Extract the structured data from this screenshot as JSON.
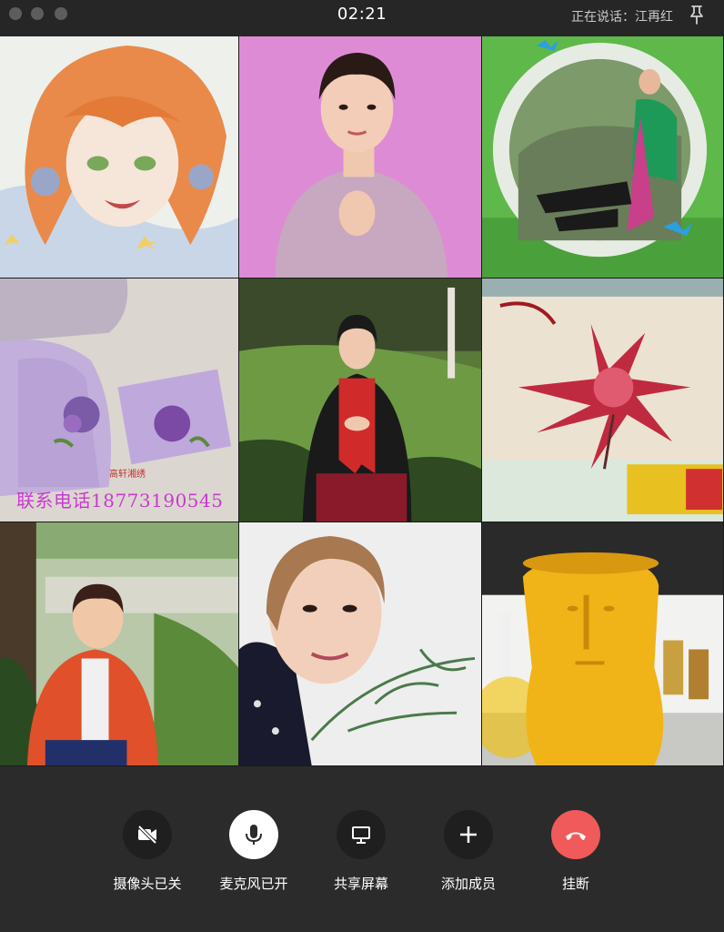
{
  "window": {
    "time": "02:21",
    "speaking_label": "正在说话：江再红"
  },
  "tiles": [
    {
      "name": "participant-tile-1",
      "subject": "anime character avatar"
    },
    {
      "name": "participant-tile-2",
      "subject": "woman in pink sweater"
    },
    {
      "name": "participant-tile-3",
      "subject": "woman sitting on grass frame"
    },
    {
      "name": "participant-tile-4",
      "subject": "embroidered silk products",
      "overlay_text": "联系电话18773190545",
      "brand_mark": "高轩湘绣"
    },
    {
      "name": "participant-tile-5",
      "subject": "woman in red scarf"
    },
    {
      "name": "participant-tile-6",
      "subject": "embroidered red flower"
    },
    {
      "name": "participant-tile-7",
      "subject": "woman in orange coat"
    },
    {
      "name": "participant-tile-8",
      "subject": "woman selfie with plant"
    },
    {
      "name": "participant-tile-9",
      "subject": "yellow statue figure"
    }
  ],
  "controls": {
    "camera": {
      "label": "摄像头已关",
      "icon": "camera-off-icon"
    },
    "mic": {
      "label": "麦克风已开",
      "icon": "microphone-icon"
    },
    "share": {
      "label": "共享屏幕",
      "icon": "screen-share-icon"
    },
    "add": {
      "label": "添加成员",
      "icon": "plus-icon"
    },
    "hangup": {
      "label": "挂断",
      "icon": "hangup-icon"
    }
  },
  "colors": {
    "background": "#2b2b2b",
    "hangup_red": "#f05a5a",
    "active_white": "#ffffff"
  }
}
